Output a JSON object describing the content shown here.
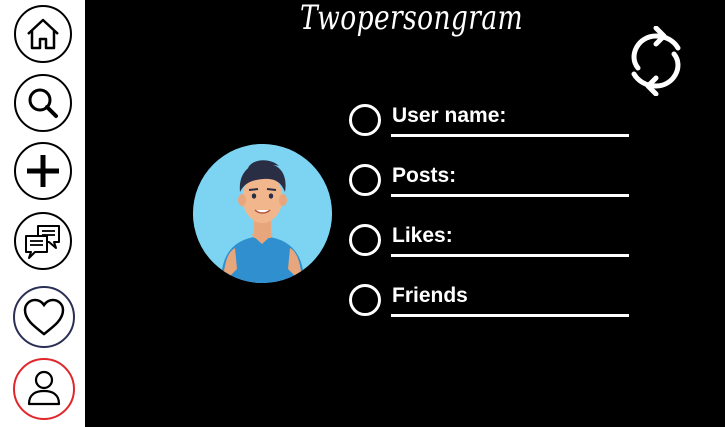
{
  "app": {
    "title": "Twopersongram"
  },
  "nav": [
    {
      "name": "home-button",
      "icon": "home-icon"
    },
    {
      "name": "search-button",
      "icon": "search-icon"
    },
    {
      "name": "add-post-button",
      "icon": "plus-icon"
    },
    {
      "name": "messages-button",
      "icon": "chat-icon"
    },
    {
      "name": "likes-button",
      "icon": "heart-icon"
    },
    {
      "name": "profile-button",
      "icon": "user-icon",
      "active": true
    }
  ],
  "colors": {
    "background": "#000000",
    "sidebar": "#ffffff",
    "active_nav": "#e0262a",
    "avatar_bg": "#7dd4f2"
  },
  "profile": {
    "avatar_icon": "person-avatar-icon",
    "fields": [
      {
        "label": "User name:"
      },
      {
        "label": "Posts:"
      },
      {
        "label": "Likes:"
      },
      {
        "label": "Friends"
      }
    ]
  },
  "actions": {
    "refresh_icon": "refresh-icon"
  }
}
